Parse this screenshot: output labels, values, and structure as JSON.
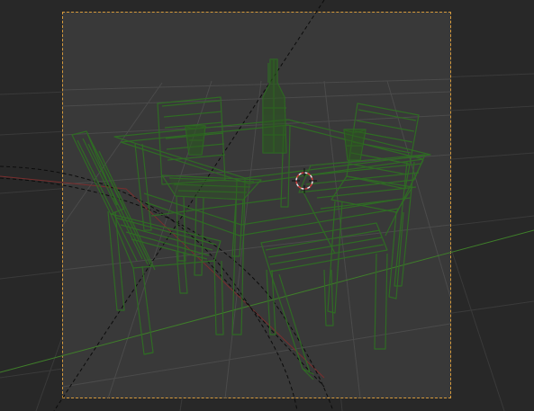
{
  "viewport": {
    "mode": "wireframe",
    "view": "camera-perspective",
    "colors": {
      "background": "#282828",
      "camera_frame_fill": "#393939",
      "camera_frame_border": "#d79b3c",
      "grid": "#4a4a4a",
      "x_axis": "#8a2f2f",
      "y_axis": "#3f7f2a",
      "wireframe": "#2f6b24",
      "wireframe_dark": "#1f4418",
      "cursor": "#e04040"
    }
  },
  "scene": {
    "objects": [
      {
        "name": "table"
      },
      {
        "name": "chair-front-left"
      },
      {
        "name": "chair-back-left"
      },
      {
        "name": "chair-back-right"
      },
      {
        "name": "chair-front-right"
      },
      {
        "name": "bottle"
      },
      {
        "name": "glass-left"
      },
      {
        "name": "glass-right"
      }
    ],
    "camera": {
      "name": "camera"
    }
  },
  "cursor": {
    "name": "3d-cursor"
  }
}
